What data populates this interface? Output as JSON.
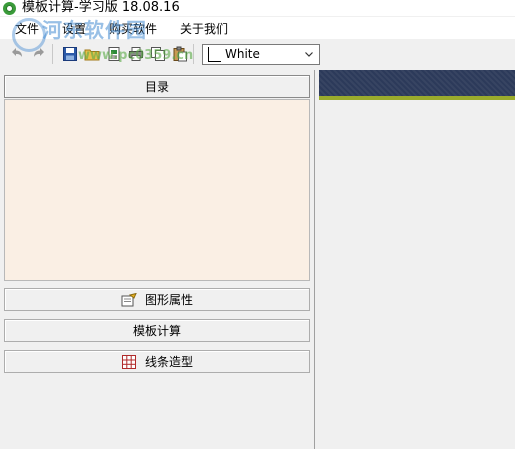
{
  "window": {
    "title": "模板计算-学习版 18.08.16"
  },
  "menu": {
    "items": [
      "文件",
      "设置",
      "购买软件",
      "关于我们"
    ]
  },
  "watermark": {
    "top": "河东软件园",
    "bottom": "www.pc0359.cn"
  },
  "toolbar": {
    "icons": [
      "undo-icon",
      "redo-icon",
      "save-icon",
      "open-folder-icon",
      "export-icon",
      "print-icon",
      "copy-icon",
      "paste-icon"
    ],
    "color_select": {
      "value": "White"
    }
  },
  "left_panel": {
    "catalog_label": "目录",
    "buttons": {
      "shape_properties": "图形属性",
      "template_calc": "模板计算",
      "line_modeling": "线条造型"
    }
  },
  "colors": {
    "catalog_bg": "#faefe4",
    "right_strip": "#2c3a5a",
    "right_accent": "#9aab2c"
  }
}
